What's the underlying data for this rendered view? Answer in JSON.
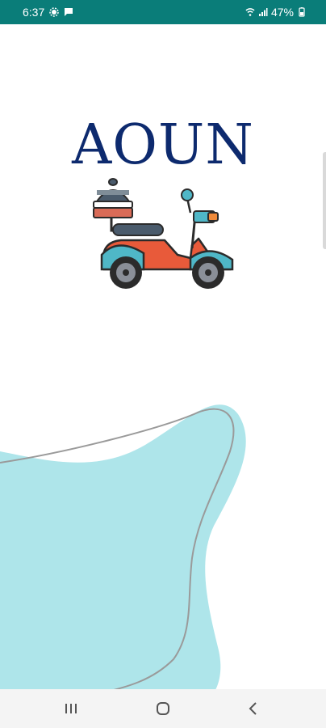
{
  "status_bar": {
    "time": "6:37",
    "battery_text": "47%",
    "left_icons": [
      "settings-icon",
      "chat-icon"
    ],
    "right_icons": [
      "wifi-icon",
      "signal-icon",
      "battery-icon"
    ]
  },
  "brand": {
    "title": "AOUN",
    "logo_icon": "delivery-scooter-icon"
  },
  "colors": {
    "status_bar": "#0a7d79",
    "title": "#0d2a6e",
    "blob": "#aee5ea",
    "scooter_body": "#e85a3a",
    "scooter_panel": "#4fb7c7",
    "wheel": "#8a8f98"
  },
  "nav_bar": {
    "icons": [
      "recent-apps-icon",
      "home-icon",
      "back-icon"
    ]
  }
}
